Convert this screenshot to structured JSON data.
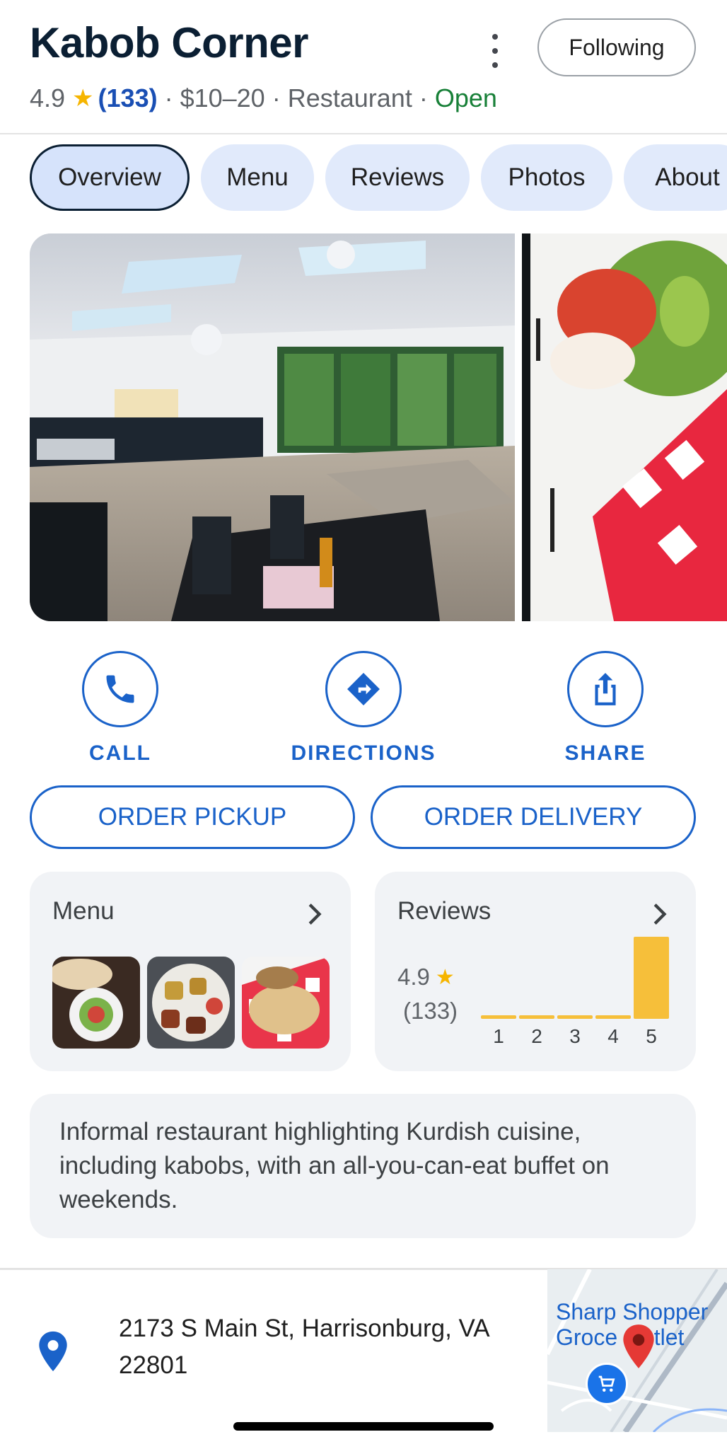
{
  "header": {
    "title": "Kabob Corner",
    "rating": "4.9",
    "review_count": "(133)",
    "price": "$10–20",
    "category": "Restaurant",
    "status": "Open",
    "follow_label": "Following",
    "more_icon": "more-vert-icon"
  },
  "tabs": [
    {
      "label": "Overview",
      "active": true
    },
    {
      "label": "Menu",
      "active": false
    },
    {
      "label": "Reviews",
      "active": false
    },
    {
      "label": "Photos",
      "active": false
    },
    {
      "label": "About",
      "active": false
    }
  ],
  "actions": {
    "call": {
      "label": "CALL",
      "icon": "phone-icon"
    },
    "directions": {
      "label": "DIRECTIONS",
      "icon": "directions-icon"
    },
    "share": {
      "label": "SHARE",
      "icon": "share-icon"
    }
  },
  "order": {
    "pickup": "ORDER PICKUP",
    "delivery": "ORDER DELIVERY"
  },
  "menu_card": {
    "title": "Menu"
  },
  "reviews_card": {
    "title": "Reviews",
    "score": "4.9",
    "count": "(133)"
  },
  "chart_data": {
    "type": "bar",
    "categories": [
      "1",
      "2",
      "3",
      "4",
      "5"
    ],
    "values": [
      3,
      3,
      2,
      4,
      121
    ],
    "title": "",
    "xlabel": "",
    "ylabel": "",
    "color": "#f6bf3a"
  },
  "description": "Informal restaurant highlighting Kurdish cuisine, including kabobs, with an all-you-can-eat buffet on weekends.",
  "address": {
    "line1": "2173 S Main St, Harrisonburg, VA",
    "line2": "22801"
  },
  "map": {
    "label_line1": "Sharp Shopper",
    "label_line2": "Groce Outlet"
  },
  "colors": {
    "accent": "#1a62c9",
    "open": "#188038",
    "star": "#f6b500",
    "card_bg": "#f1f3f6"
  }
}
